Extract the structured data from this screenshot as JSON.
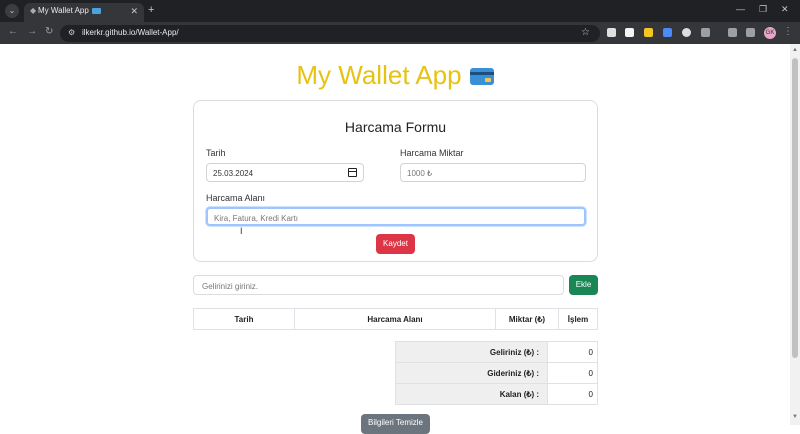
{
  "browser": {
    "tab_title": "My Wallet App",
    "new_tab": "+",
    "url": "ilkerkr.github.io/Wallet-App/",
    "profile_initials": "GK"
  },
  "app": {
    "title": "My Wallet App",
    "form": {
      "title": "Harcama Formu",
      "date_label": "Tarih",
      "date_value": "25.03.2024",
      "amount_label": "Harcama Miktar",
      "amount_placeholder": "1000 ₺",
      "area_label": "Harcama Alanı",
      "area_placeholder": "Kira, Fatura, Kredi Kartı",
      "save_button": "Kaydet"
    },
    "income": {
      "placeholder": "Gelirinizi giriniz.",
      "add_button": "Ekle"
    },
    "table": {
      "headers": [
        "Tarih",
        "Harcama Alanı",
        "Miktar (₺)",
        "İşlem"
      ]
    },
    "summary": {
      "rows": [
        {
          "label": "Geliriniz (₺) :",
          "value": "0"
        },
        {
          "label": "Gideriniz (₺) :",
          "value": "0"
        },
        {
          "label": "Kalan (₺) :",
          "value": "0"
        }
      ]
    },
    "clear_button": "Bilgileri Temizle"
  }
}
